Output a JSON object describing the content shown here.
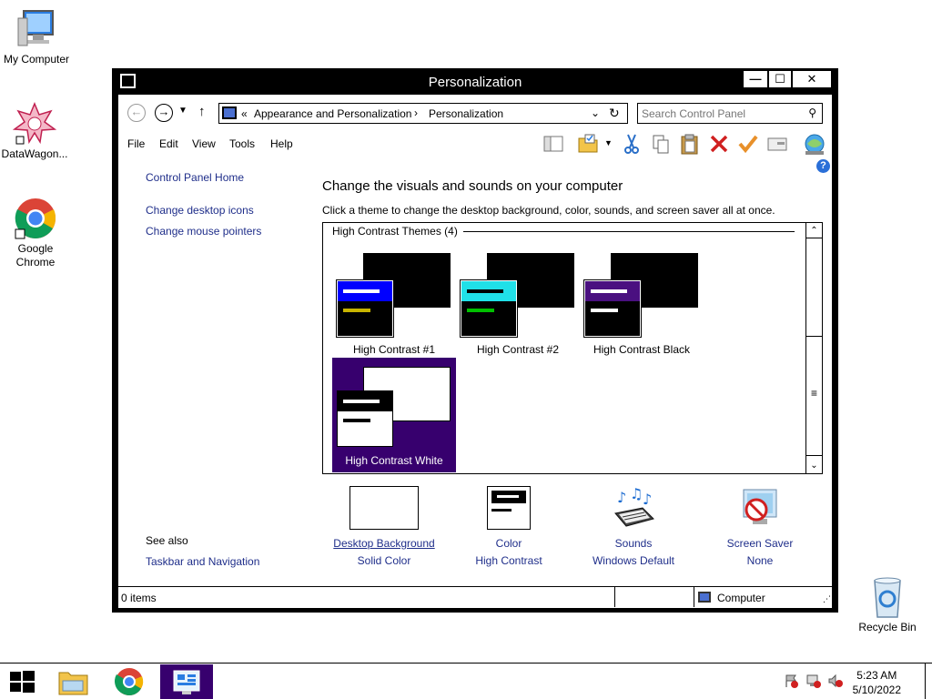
{
  "desktop": {
    "icons": [
      {
        "label": "My Computer"
      },
      {
        "label": "DataWagon..."
      },
      {
        "label": "Google Chrome"
      },
      {
        "label": "Recycle Bin"
      }
    ]
  },
  "window": {
    "title": "Personalization",
    "controls": {
      "minimize": "—",
      "maximize": "☐",
      "close": "✕"
    }
  },
  "address": {
    "prefix": "«",
    "crumbs": [
      "Appearance and Personalization",
      "Personalization"
    ],
    "separator": "›"
  },
  "search": {
    "placeholder": "Search Control Panel"
  },
  "menu": [
    "File",
    "Edit",
    "View",
    "Tools",
    "Help"
  ],
  "left_panel": {
    "home": "Control Panel Home",
    "links": [
      "Change desktop icons",
      "Change mouse pointers"
    ],
    "see_also_title": "See also",
    "see_also": [
      "Taskbar and Navigation"
    ]
  },
  "main": {
    "heading": "Change the visuals and sounds on your computer",
    "subtitle": "Click a theme to change the desktop background, color, sounds, and screen saver all at once.",
    "group_header": "High Contrast Themes (4)",
    "themes": [
      {
        "label": "High Contrast #1",
        "accent": "#0000ff",
        "bar1": "#ffffff",
        "bar2": "#c8b400"
      },
      {
        "label": "High Contrast #2",
        "accent": "#20e0e8",
        "bar1": "#000000",
        "bar2": "#00c000"
      },
      {
        "label": "High Contrast Black",
        "accent": "#4a1080",
        "bar1": "#ffffff",
        "bar2": "#ffffff"
      },
      {
        "label": "High Contrast White",
        "accent": "#000000",
        "bar1": "#ffffff",
        "bar2": "#000000"
      }
    ],
    "selected_theme": "High Contrast White"
  },
  "bottom_items": [
    {
      "caption": "Desktop Background",
      "value": "Solid Color"
    },
    {
      "caption": "Color",
      "value": "High Contrast"
    },
    {
      "caption": "Sounds",
      "value": "Windows Default"
    },
    {
      "caption": "Screen Saver",
      "value": "None"
    }
  ],
  "status": {
    "items": "0 items",
    "location": "Computer"
  },
  "taskbar": {
    "time": "5:23 AM",
    "date": "5/10/2022"
  },
  "colors": {
    "link": "#1f2e8a",
    "selection": "#37006e",
    "chrome": "#000000"
  }
}
